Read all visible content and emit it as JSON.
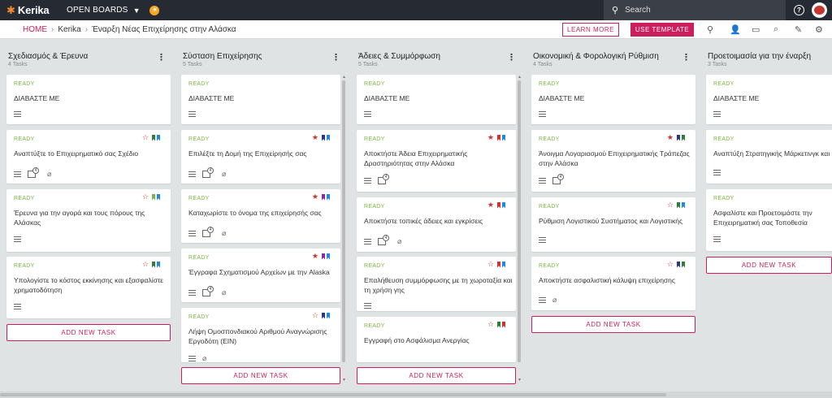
{
  "app": {
    "logo": "Kerika",
    "open_boards": "OPEN BOARDS"
  },
  "search": {
    "placeholder": "Search"
  },
  "breadcrumb": {
    "home": "HOME",
    "org": "Kerika",
    "board": "Έναρξη Νέας Επιχείρησης στην Αλάσκα"
  },
  "actions": {
    "learn_more": "LEARN MORE",
    "use_template": "USE TEMPLATE"
  },
  "colors": {
    "accent": "#cc1e5d",
    "ready": "#7cb342",
    "topbar": "#262a33"
  },
  "columns": [
    {
      "title": "Σχεδιασμός & Έρευνα",
      "count": "4 Tasks",
      "cards": [
        {
          "status": "READY",
          "title": "ΔΙΑΒΑΣΤΕ ΜΕ"
        },
        {
          "status": "READY",
          "title": "Αναπτύξτε το Επιχειρηματικό σας Σχέδιο"
        },
        {
          "status": "READY",
          "title": "Έρευνα για την αγορά και τους πόρους της Αλάσκας"
        },
        {
          "status": "READY",
          "title": "Υπολογίστε το κόστος εκκίνησης και εξασφαλίστε χρηματοδότηση"
        }
      ],
      "add_label": "ADD NEW TASK"
    },
    {
      "title": "Σύσταση Επιχείρησης",
      "count": "5 Tasks",
      "cards": [
        {
          "status": "READY",
          "title": "ΔΙΑΒΑΣΤΕ ΜΕ"
        },
        {
          "status": "READY",
          "title": "Επιλέξτε τη Δομή της Επιχείρησής σας"
        },
        {
          "status": "READY",
          "title": "Καταχωρίστε το όνομα της επιχείρησής σας"
        },
        {
          "status": "READY",
          "title": "Έγγραφα Σχηματισμού Αρχείων με την Alaska"
        },
        {
          "status": "READY",
          "title": "Λήψη Ομοσπονδιακού Αριθμού Αναγνώρισης Εργοδότη (EIN)"
        }
      ],
      "add_label": "ADD NEW TASK"
    },
    {
      "title": "Άδειες & Συμμόρφωση",
      "count": "5 Tasks",
      "cards": [
        {
          "status": "READY",
          "title": "ΔΙΑΒΑΣΤΕ ΜΕ"
        },
        {
          "status": "READY",
          "title": "Αποκτήστε Άδεια Επιχειρηματικής Δραστηριότητας στην Αλάσκα"
        },
        {
          "status": "READY",
          "title": "Αποκτήστε τοπικές άδειες και εγκρίσεις"
        },
        {
          "status": "READY",
          "title": "Επαλήθευση συμμόρφωσης με τη χωροταξία και τη χρήση γης"
        },
        {
          "status": "READY",
          "title": "Εγγραφή στο Ασφάλισμα Ανεργίας"
        }
      ],
      "add_label": "ADD NEW TASK"
    },
    {
      "title": "Οικονομική & Φορολογική Ρύθμιση",
      "count": "4 Tasks",
      "cards": [
        {
          "status": "READY",
          "title": "ΔΙΑΒΑΣΤΕ ΜΕ"
        },
        {
          "status": "READY",
          "title": "Άνοιγμα Λογαριασμού Επιχειρηματικής Τράπεζας στην Αλάσκα"
        },
        {
          "status": "READY",
          "title": "Ρύθμιση Λογιστικού Συστήματος και Λογιστικής"
        },
        {
          "status": "READY",
          "title": "Αποκτήστε ασφαλιστική κάλυψη επιχείρησης"
        }
      ],
      "add_label": "ADD NEW TASK"
    },
    {
      "title": "Προετοιμασία για την έναρξη",
      "count": "3 Tasks",
      "cards": [
        {
          "status": "READY",
          "title": "ΔΙΑΒΑΣΤΕ ΜΕ"
        },
        {
          "status": "READY",
          "title": "Αναπτύξη Στρατηγικής Μάρκετινγκ και"
        },
        {
          "status": "READY",
          "title": "Ασφαλίστε και Προετοιμάστε την Επιχειρηματική σας Τοποθεσία"
        }
      ],
      "add_label": "ADD NEW TASK"
    }
  ]
}
